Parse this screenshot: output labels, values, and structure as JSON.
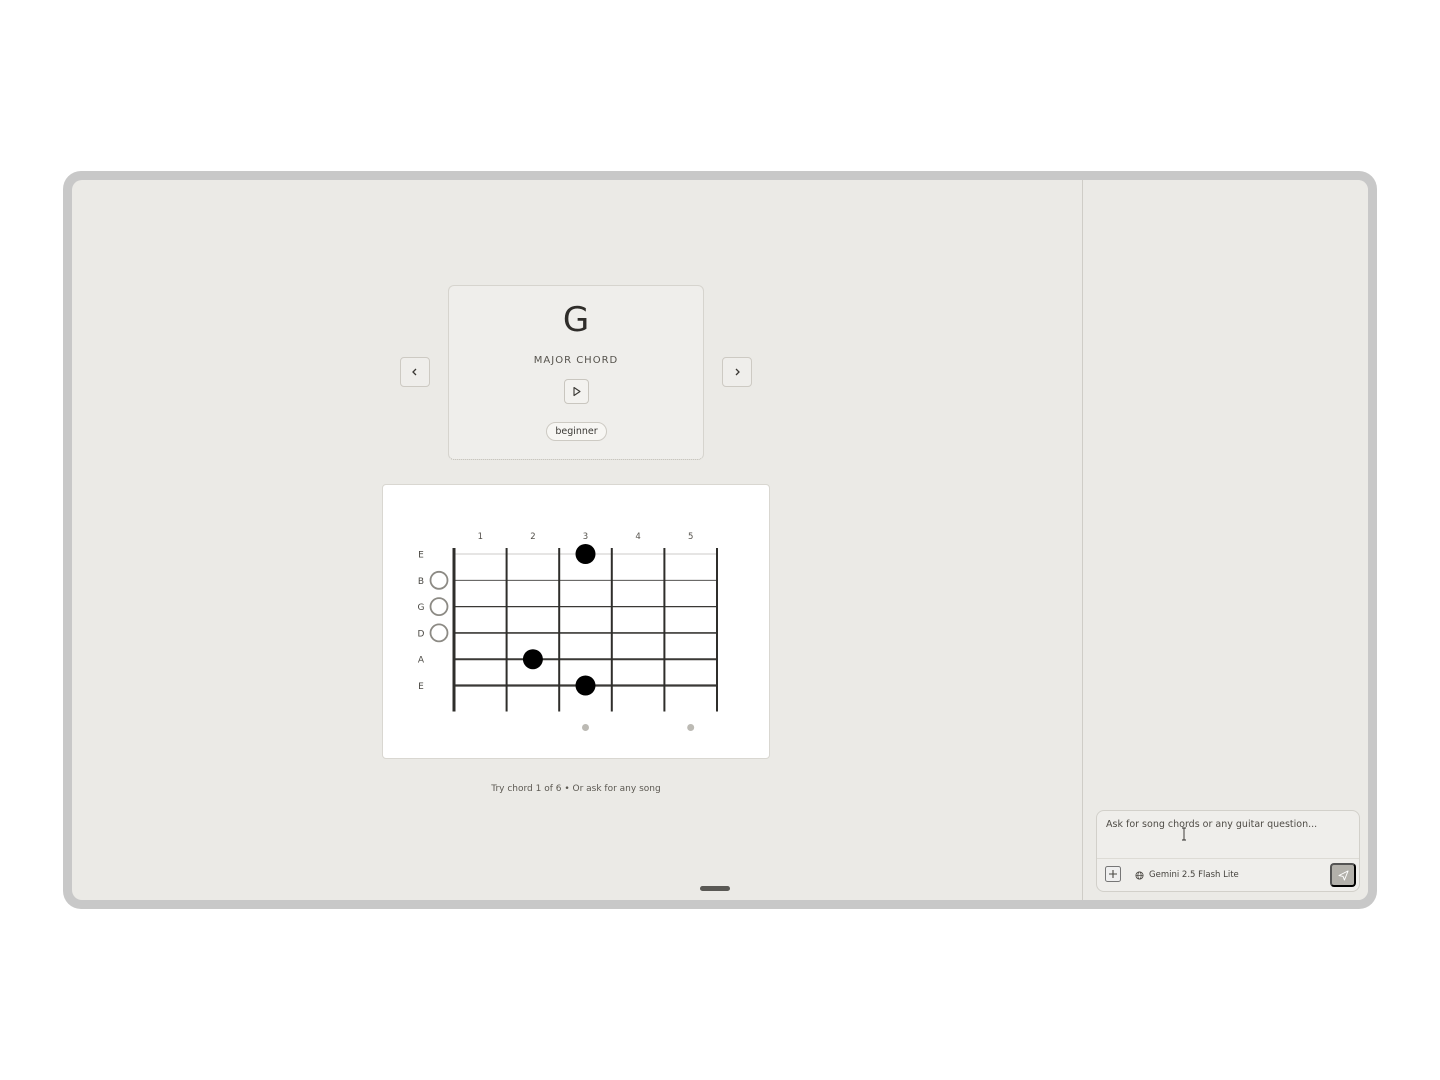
{
  "chord": {
    "name": "G",
    "type": "MAJOR CHORD",
    "level": "beginner"
  },
  "navigation": {
    "prev_icon": "chevron-left-icon",
    "next_icon": "chevron-right-icon"
  },
  "diagram": {
    "fret_numbers": [
      "1",
      "2",
      "3",
      "4",
      "5"
    ],
    "strings": [
      "E",
      "B",
      "G",
      "D",
      "A",
      "E"
    ],
    "open_strings": [
      "B",
      "G",
      "D"
    ],
    "fingers": [
      {
        "string_index": 0,
        "fret": 3
      },
      {
        "string_index": 4,
        "fret": 2
      },
      {
        "string_index": 5,
        "fret": 3
      }
    ],
    "inlay_frets": [
      3,
      5
    ]
  },
  "hint": "Try chord 1 of 6 • Or ask for any song",
  "composer": {
    "placeholder": "Ask for song chords or any guitar question...",
    "model": "Gemini 2.5 Flash Lite",
    "model_icon": "globe-icon",
    "add_icon": "plus-icon",
    "send_icon": "send-icon"
  },
  "colors": {
    "background": "#ebeae6",
    "frame": "#c8c8c8",
    "card": "#efeeeb",
    "send_button": "#b3b1ab"
  }
}
